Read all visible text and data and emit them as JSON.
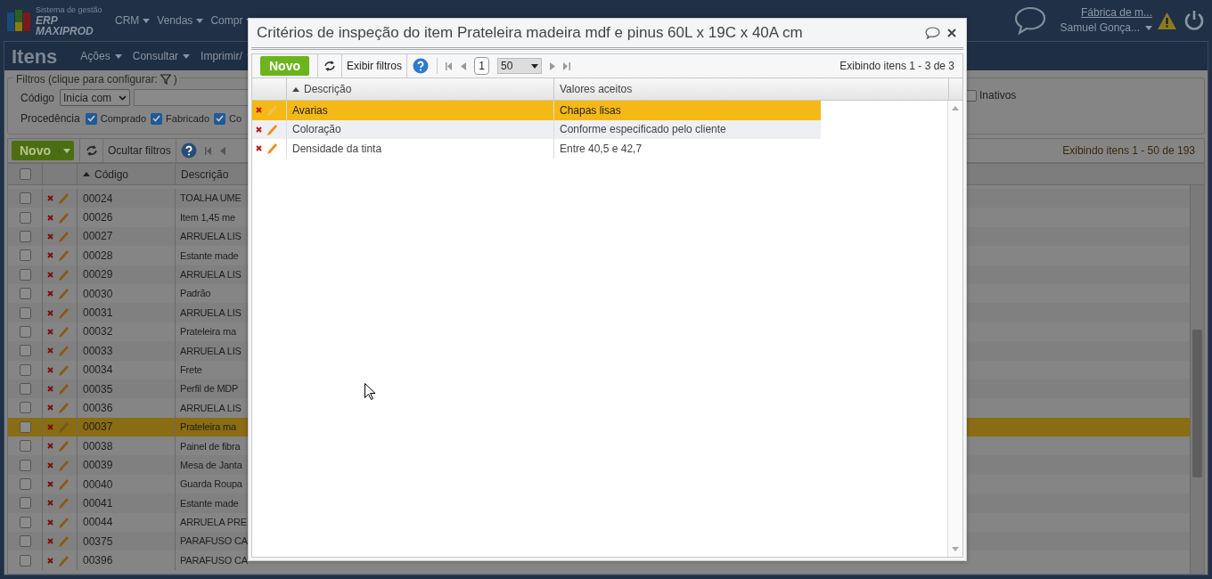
{
  "top_nav": {
    "logo": {
      "tagline": "Sistema de gestão",
      "product": "ERP MAXIPROD"
    },
    "menu": [
      {
        "label": "CRM"
      },
      {
        "label": "Vendas"
      },
      {
        "label": "Compr"
      }
    ],
    "company": "Fábrica de m...",
    "user": "Samuel Gonça..."
  },
  "page": {
    "title": "Itens",
    "menu": [
      "Ações",
      "Consultar",
      "Imprimir/"
    ]
  },
  "filters": {
    "legend": "Filtros (clique para configurar:",
    "legend_end": ")",
    "code_label": "Código",
    "code_operator": "Inicia com",
    "origin_label": "Procedência",
    "origin_options": [
      {
        "label": "Comprado",
        "checked": true
      },
      {
        "label": "Fabricado",
        "checked": true
      },
      {
        "label": "Co",
        "checked": true
      }
    ],
    "inactive": {
      "label": "Inativos",
      "checked": false
    }
  },
  "toolbar": {
    "new": "Novo",
    "toggle_filters": "Ocultar filtros",
    "summary": "Exibindo itens 1 - 50 de 193"
  },
  "table": {
    "all_checked": false,
    "columns": [
      {
        "label": "Código",
        "sorted": true
      },
      {
        "label": "Descrição",
        "sorted": false
      }
    ],
    "rows": [
      {
        "code": "00024",
        "description": "TOALHA UME",
        "selected": false,
        "checked": false
      },
      {
        "code": "00026",
        "description": "Item 1,45 me",
        "selected": false,
        "checked": false
      },
      {
        "code": "00027",
        "description": "ARRUELA LIS",
        "selected": false,
        "checked": false
      },
      {
        "code": "00028",
        "description": "Estante made",
        "selected": false,
        "checked": false
      },
      {
        "code": "00029",
        "description": "ARRUELA LIS",
        "selected": false,
        "checked": false
      },
      {
        "code": "00030",
        "description": "Padrão",
        "selected": false,
        "checked": false
      },
      {
        "code": "00031",
        "description": "ARRUELA LIS",
        "selected": false,
        "checked": false
      },
      {
        "code": "00032",
        "description": "Prateleira ma",
        "selected": false,
        "checked": false
      },
      {
        "code": "00033",
        "description": "ARRUELA LIS",
        "selected": false,
        "checked": false
      },
      {
        "code": "00034",
        "description": "Frete",
        "selected": false,
        "checked": false
      },
      {
        "code": "00035",
        "description": "Perfil de MDP",
        "selected": false,
        "checked": false
      },
      {
        "code": "00036",
        "description": "ARRUELA LIS",
        "selected": false,
        "checked": false
      },
      {
        "code": "00037",
        "description": "Prateleira ma",
        "selected": true,
        "checked": false
      },
      {
        "code": "00038",
        "description": "Painel de fibra",
        "selected": false,
        "checked": false
      },
      {
        "code": "00039",
        "description": "Mesa de Janta",
        "selected": false,
        "checked": false
      },
      {
        "code": "00040",
        "description": "Guarda Roupa",
        "selected": false,
        "checked": false
      },
      {
        "code": "00041",
        "description": "Estante made",
        "selected": false,
        "checked": false
      },
      {
        "code": "00044",
        "description": "ARRUELA PRE",
        "selected": false,
        "checked": false
      },
      {
        "code": "00375",
        "description": "PARAFUSO CA",
        "selected": false,
        "checked": false
      },
      {
        "code": "00396",
        "description": "PARAFUSO CA",
        "selected": false,
        "checked": false
      }
    ]
  },
  "dialog": {
    "title": "Critérios de inspeção do item Prateleira madeira mdf e pinus 60L x 19C x 40A cm",
    "toolbar": {
      "new": "Novo",
      "toggle_filters": "Exibir filtros",
      "page": "1",
      "page_size": "50",
      "summary": "Exibindo itens 1 - 3 de 3"
    },
    "columns": [
      {
        "label": "Descrição",
        "sorted": true
      },
      {
        "label": "Valores aceitos",
        "sorted": false
      }
    ],
    "rows": [
      {
        "description": "Avarias",
        "accepted": "Chapas lisas",
        "selected": true
      },
      {
        "description": "Coloração",
        "accepted": "Conforme especificado pelo cliente",
        "selected": false
      },
      {
        "description": "Densidade da tinta",
        "accepted": "Entre 40,5 e 42,7",
        "selected": false
      }
    ]
  }
}
